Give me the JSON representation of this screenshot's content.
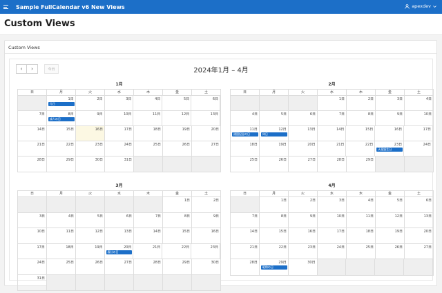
{
  "app": {
    "title": "Sample FullCalendar v6 New Views",
    "user": "apexdev"
  },
  "page": {
    "title": "Custom Views"
  },
  "region": {
    "title": "Custom Views"
  },
  "toolbar": {
    "prev_icon": "‹",
    "next_icon": "›",
    "today_label": "今日",
    "range_title": "2024年1月 – 4月"
  },
  "weekdays": [
    "日",
    "月",
    "火",
    "水",
    "木",
    "金",
    "土"
  ],
  "months": [
    {
      "title": "1月",
      "weeks": [
        [
          {
            "d": "",
            "o": true
          },
          {
            "d": "1日"
          },
          {
            "d": "2日"
          },
          {
            "d": "3日"
          },
          {
            "d": "4日"
          },
          {
            "d": "5日"
          },
          {
            "d": "6日"
          }
        ],
        [
          {
            "d": "7日"
          },
          {
            "d": "8日"
          },
          {
            "d": "9日"
          },
          {
            "d": "10日"
          },
          {
            "d": "11日"
          },
          {
            "d": "12日"
          },
          {
            "d": "13日"
          }
        ],
        [
          {
            "d": "14日"
          },
          {
            "d": "15日"
          },
          {
            "d": "16日",
            "t": true
          },
          {
            "d": "17日"
          },
          {
            "d": "18日"
          },
          {
            "d": "19日"
          },
          {
            "d": "20日"
          }
        ],
        [
          {
            "d": "21日"
          },
          {
            "d": "22日"
          },
          {
            "d": "23日"
          },
          {
            "d": "24日"
          },
          {
            "d": "25日"
          },
          {
            "d": "26日"
          },
          {
            "d": "27日"
          }
        ],
        [
          {
            "d": "28日"
          },
          {
            "d": "29日"
          },
          {
            "d": "30日"
          },
          {
            "d": "31日"
          },
          {
            "d": "",
            "o": true
          },
          {
            "d": "",
            "o": true
          },
          {
            "d": "",
            "o": true
          }
        ]
      ],
      "events": [
        {
          "title": "元日",
          "week": 0,
          "day": 1
        },
        {
          "title": "成人の日",
          "week": 1,
          "day": 1
        }
      ]
    },
    {
      "title": "2月",
      "weeks": [
        [
          {
            "d": "",
            "o": true
          },
          {
            "d": "",
            "o": true
          },
          {
            "d": "",
            "o": true
          },
          {
            "d": "1日"
          },
          {
            "d": "2日"
          },
          {
            "d": "3日"
          },
          {
            "d": "4日"
          }
        ],
        [
          {
            "d": "4日"
          },
          {
            "d": "5日"
          },
          {
            "d": "6日"
          },
          {
            "d": "7日"
          },
          {
            "d": "8日"
          },
          {
            "d": "9日"
          },
          {
            "d": "10日"
          }
        ],
        [
          {
            "d": "11日"
          },
          {
            "d": "12日"
          },
          {
            "d": "13日"
          },
          {
            "d": "14日"
          },
          {
            "d": "15日"
          },
          {
            "d": "16日"
          },
          {
            "d": "17日"
          }
        ],
        [
          {
            "d": "18日"
          },
          {
            "d": "19日"
          },
          {
            "d": "20日"
          },
          {
            "d": "21日"
          },
          {
            "d": "22日"
          },
          {
            "d": "23日"
          },
          {
            "d": "24日"
          }
        ],
        [
          {
            "d": "25日"
          },
          {
            "d": "26日"
          },
          {
            "d": "27日"
          },
          {
            "d": "28日"
          },
          {
            "d": "29日"
          },
          {
            "d": "",
            "o": true
          },
          {
            "d": "",
            "o": true
          }
        ]
      ],
      "events": [
        {
          "title": "建国記念の日",
          "week": 2,
          "day": 0
        },
        {
          "title": "休日",
          "week": 2,
          "day": 1
        },
        {
          "title": "天皇誕生日",
          "week": 3,
          "day": 5
        }
      ]
    },
    {
      "title": "3月",
      "weeks": [
        [
          {
            "d": "",
            "o": true
          },
          {
            "d": "",
            "o": true
          },
          {
            "d": "",
            "o": true
          },
          {
            "d": "",
            "o": true
          },
          {
            "d": "",
            "o": true
          },
          {
            "d": "1日"
          },
          {
            "d": "2日"
          }
        ],
        [
          {
            "d": "3日"
          },
          {
            "d": "4日"
          },
          {
            "d": "5日"
          },
          {
            "d": "6日"
          },
          {
            "d": "7日"
          },
          {
            "d": "8日"
          },
          {
            "d": "9日"
          }
        ],
        [
          {
            "d": "10日"
          },
          {
            "d": "11日"
          },
          {
            "d": "12日"
          },
          {
            "d": "13日"
          },
          {
            "d": "14日"
          },
          {
            "d": "15日"
          },
          {
            "d": "16日"
          }
        ],
        [
          {
            "d": "17日"
          },
          {
            "d": "18日"
          },
          {
            "d": "19日"
          },
          {
            "d": "20日"
          },
          {
            "d": "21日"
          },
          {
            "d": "22日"
          },
          {
            "d": "23日"
          }
        ],
        [
          {
            "d": "24日"
          },
          {
            "d": "25日"
          },
          {
            "d": "26日"
          },
          {
            "d": "27日"
          },
          {
            "d": "28日"
          },
          {
            "d": "29日"
          },
          {
            "d": "30日"
          }
        ],
        [
          {
            "d": "31日"
          },
          {
            "d": "",
            "o": true
          },
          {
            "d": "",
            "o": true
          },
          {
            "d": "",
            "o": true
          },
          {
            "d": "",
            "o": true
          },
          {
            "d": "",
            "o": true
          },
          {
            "d": "",
            "o": true
          }
        ]
      ],
      "events": [
        {
          "title": "春分の日",
          "week": 3,
          "day": 3
        }
      ]
    },
    {
      "title": "4月",
      "weeks": [
        [
          {
            "d": "",
            "o": true
          },
          {
            "d": "1日"
          },
          {
            "d": "2日"
          },
          {
            "d": "3日"
          },
          {
            "d": "4日"
          },
          {
            "d": "5日"
          },
          {
            "d": "6日"
          }
        ],
        [
          {
            "d": "7日"
          },
          {
            "d": "8日"
          },
          {
            "d": "9日"
          },
          {
            "d": "10日"
          },
          {
            "d": "11日"
          },
          {
            "d": "12日"
          },
          {
            "d": "13日"
          }
        ],
        [
          {
            "d": "14日"
          },
          {
            "d": "15日"
          },
          {
            "d": "16日"
          },
          {
            "d": "17日"
          },
          {
            "d": "18日"
          },
          {
            "d": "19日"
          },
          {
            "d": "20日"
          }
        ],
        [
          {
            "d": "21日"
          },
          {
            "d": "22日"
          },
          {
            "d": "23日"
          },
          {
            "d": "24日"
          },
          {
            "d": "25日"
          },
          {
            "d": "26日"
          },
          {
            "d": "27日"
          }
        ],
        [
          {
            "d": "28日"
          },
          {
            "d": "29日"
          },
          {
            "d": "30日"
          },
          {
            "d": "",
            "o": true
          },
          {
            "d": "",
            "o": true
          },
          {
            "d": "",
            "o": true
          },
          {
            "d": "",
            "o": true
          }
        ]
      ],
      "events": [
        {
          "title": "昭和の日",
          "week": 4,
          "day": 1
        }
      ]
    }
  ]
}
